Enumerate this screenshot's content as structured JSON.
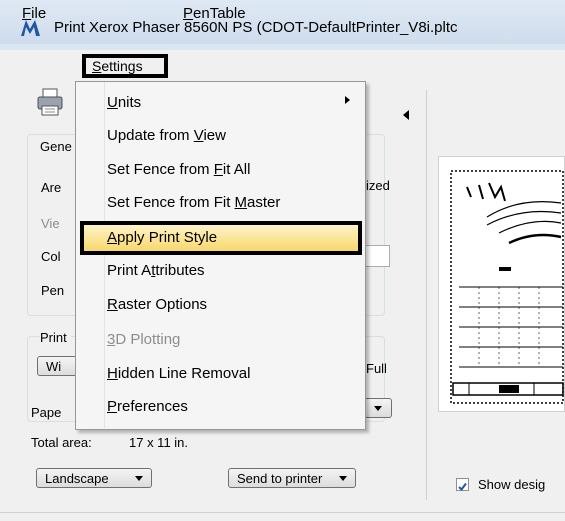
{
  "window": {
    "title": "Print  Xerox Phaser 8560N PS  (CDOT-DefaultPrinter_V8i.pltc"
  },
  "menubar": {
    "items": [
      {
        "label_pre": "",
        "accel": "F",
        "label_post": "ile"
      },
      {
        "label_pre": "",
        "accel": "S",
        "label_post": "ettings"
      },
      {
        "label_pre": "",
        "accel": "P",
        "label_post": "enTable"
      }
    ]
  },
  "settings_menu": {
    "items": [
      {
        "pre": "",
        "accel": "U",
        "post": "nits",
        "submenu": true,
        "disabled": false
      },
      {
        "pre": "Update from ",
        "accel": "V",
        "post": "iew",
        "disabled": false
      },
      {
        "pre": "Set Fence from ",
        "accel": "F",
        "post": "it All",
        "disabled": false
      },
      {
        "pre": "Set Fence from Fit ",
        "accel": "M",
        "post": "aster",
        "disabled": false
      },
      {
        "pre": "",
        "accel": "A",
        "post": "pply Print Style",
        "disabled": false,
        "highlighted": true
      },
      {
        "pre": "Print A",
        "accel": "t",
        "post": "tributes",
        "disabled": false
      },
      {
        "pre": "",
        "accel": "R",
        "post": "aster Options",
        "disabled": false
      },
      {
        "pre": "",
        "accel": "3",
        "post": "D Plotting",
        "disabled": true
      },
      {
        "pre": "",
        "accel": "H",
        "post": "idden Line Removal",
        "disabled": false
      },
      {
        "pre": "",
        "accel": "P",
        "post": "references",
        "disabled": false
      }
    ]
  },
  "general_group": {
    "legend": "Gene",
    "area_label": "Are",
    "view_label": "Vie",
    "color_label": "Col",
    "pen_label": "Pen",
    "rasterized_label": "ized"
  },
  "print_group": {
    "legend": "Print",
    "window_button": "Wi",
    "full_label": "Full",
    "paper_label": "Pape",
    "total_area_label": "Total area:",
    "total_area_value": "17 x 11 in.",
    "orientation": "Landscape",
    "destination": "Send to printer"
  },
  "preview": {
    "show_design_label": "Show desig",
    "show_design_checked": true
  },
  "colors": {
    "highlight_top": "#fdf3c9",
    "highlight_bottom": "#f8d86b",
    "callout_border": "#000000",
    "disabled_text": "#8d8d8d"
  }
}
